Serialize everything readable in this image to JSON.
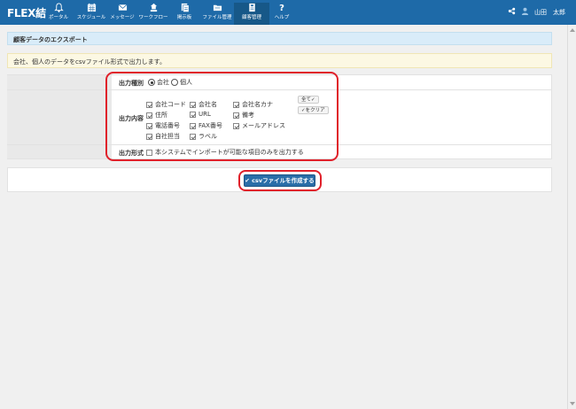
{
  "header": {
    "logo": "FLEX結",
    "nav": [
      {
        "label": "ポータル",
        "icon": "bell-icon"
      },
      {
        "label": "スケジュール",
        "icon": "calendar-icon"
      },
      {
        "label": "メッセージ",
        "icon": "mail-icon"
      },
      {
        "label": "ワークフロー",
        "icon": "workflow-icon"
      },
      {
        "label": "掲示板",
        "icon": "bulletin-icon"
      },
      {
        "label": "ファイル管理",
        "icon": "folder-icon"
      },
      {
        "label": "顧客管理",
        "icon": "customer-icon"
      },
      {
        "label": "ヘルプ",
        "icon": "help-icon"
      }
    ],
    "user_name": "山田　太郎"
  },
  "page": {
    "title": "顧客データのエクスポート",
    "info": "会社、個人のデータをcsvファイル形式で出力します。"
  },
  "form": {
    "type_label": "出力種別",
    "type_options": [
      "会社",
      "個人"
    ],
    "type_selected": "会社",
    "content_label": "出力内容",
    "content_items": [
      {
        "label": "会社コード",
        "checked": true
      },
      {
        "label": "会社名",
        "checked": true
      },
      {
        "label": "会社名カナ",
        "checked": true
      },
      {
        "label": "住所",
        "checked": true
      },
      {
        "label": "URL",
        "checked": true
      },
      {
        "label": "備考",
        "checked": true
      },
      {
        "label": "電話番号",
        "checked": true
      },
      {
        "label": "FAX番号",
        "checked": true
      },
      {
        "label": "メールアドレス",
        "checked": true
      },
      {
        "label": "自社担当",
        "checked": true
      },
      {
        "label": "ラベル",
        "checked": true
      }
    ],
    "select_all": "全て✓",
    "clear_all": "✓をクリア",
    "format_label": "出力形式",
    "format_option": "本システムでインポートが可能な項目のみを出力する"
  },
  "actions": {
    "create_csv": "✔ csvファイルを作成する"
  },
  "colors": {
    "header": "#1e6aa8",
    "highlight": "#e0202a",
    "primary": "#2a6ea8"
  }
}
